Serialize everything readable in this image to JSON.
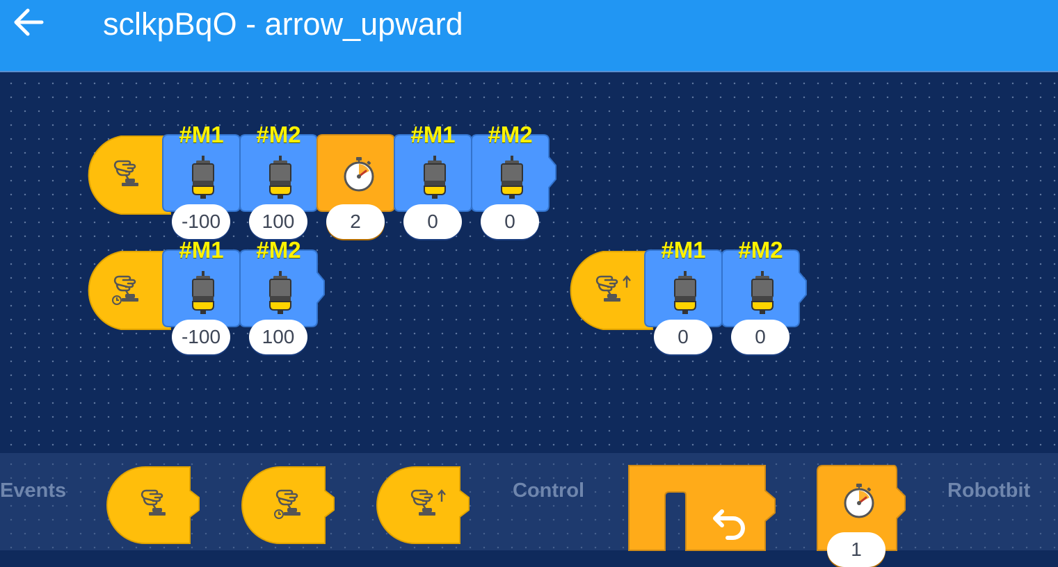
{
  "header": {
    "title": "sclkpBqO - arrow_upward",
    "back_icon": "arrow-left-icon"
  },
  "workspace": {
    "program1": {
      "blocks": [
        {
          "label": "#M1",
          "value": "-100"
        },
        {
          "label": "#M2",
          "value": "100"
        },
        {
          "timer_value": "2"
        },
        {
          "label": "#M1",
          "value": "0"
        },
        {
          "label": "#M2",
          "value": "0"
        }
      ]
    },
    "program2": {
      "blocks": [
        {
          "label": "#M1",
          "value": "-100"
        },
        {
          "label": "#M2",
          "value": "100"
        }
      ]
    },
    "program3": {
      "blocks": [
        {
          "label": "#M1",
          "value": "0"
        },
        {
          "label": "#M2",
          "value": "0"
        }
      ]
    }
  },
  "palette": {
    "categories": [
      "Events",
      "Control",
      "Robotbit"
    ],
    "timer_value": "1"
  },
  "colors": {
    "appbar": "#2196f3",
    "workspace": "#0f2a5c",
    "event_block": "#ffbe0b",
    "motor_block": "#4c97ff",
    "control_block": "#ffab19",
    "motor_label": "#fff200"
  }
}
